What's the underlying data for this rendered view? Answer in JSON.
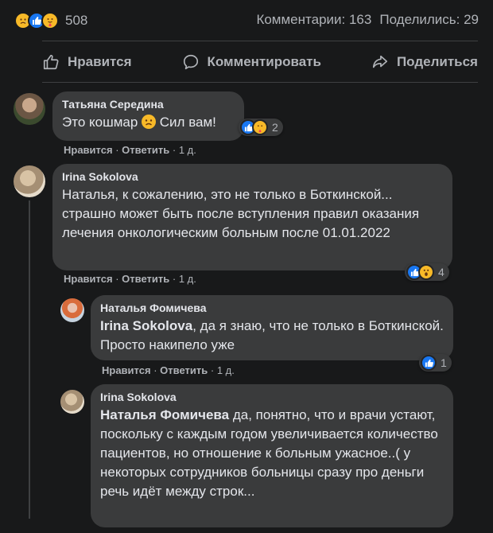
{
  "summary": {
    "reaction_icons": [
      "sad-face-icon",
      "thumbs-up-icon",
      "care-hug-icon"
    ],
    "reaction_count": "508",
    "comments": "Комментарии: 163",
    "shares": "Поделились: 29"
  },
  "actions": {
    "like": "Нравится",
    "comment": "Комментировать",
    "share": "Поделиться"
  },
  "comments": [
    {
      "author": "Татьяна Середина",
      "text": "Это кошмар",
      "text_after": "Сил вам!",
      "like": "Нравится",
      "reply": "Ответить",
      "time": "1 д.",
      "reactions_count": "2",
      "reaction_icons": [
        "thumbs-up-icon",
        "care-hug-icon"
      ]
    },
    {
      "author": "Irina Sokolova",
      "text": "Наталья, к сожалению, это не только в Боткинской... страшно может быть после вступления правил оказания лечения онкологическим больным после 01.01.2022",
      "like": "Нравится",
      "reply": "Ответить",
      "time": "1 д.",
      "reactions_count": "4",
      "reaction_icons": [
        "thumbs-up-icon",
        "wow-face-icon"
      ]
    },
    {
      "author": "Наталья Фомичева",
      "mention": "Irina Sokolova",
      "text": ", да я знаю, что не только в Боткинской. Просто накипело уже",
      "like": "Нравится",
      "reply": "Ответить",
      "time": "1 д.",
      "reactions_count": "1",
      "reaction_icons": [
        "thumbs-up-icon"
      ]
    },
    {
      "author": "Irina Sokolova",
      "mention": "Наталья Фомичева",
      "text": " да, понятно, что и врачи устают, поскольку с каждым годом увеличивается количество пациентов, но отношение к больным ужасное..( у некоторых сотрудников больницы сразу про деньги речь идёт между строк..."
    }
  ],
  "separator": "·",
  "colors": {
    "background": "#18191a",
    "bubble": "#3a3b3c",
    "text": "#e4e6eb",
    "secondary": "#b0b3b8",
    "like_blue": "#1877f2",
    "emoji_yellow": "#f7b928"
  }
}
